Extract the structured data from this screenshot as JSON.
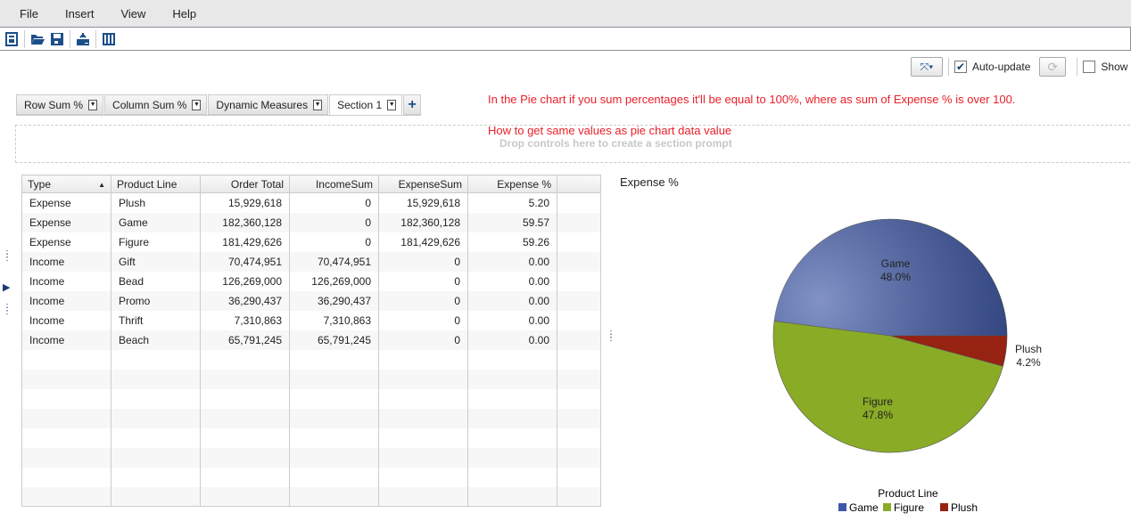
{
  "menu": [
    "File",
    "Insert",
    "View",
    "Help"
  ],
  "toolbar_icons": [
    "new-report-icon",
    "open-folder-icon",
    "save-icon",
    "export-icon",
    "layout-icon"
  ],
  "right_tools": {
    "auto_update_label": "Auto-update",
    "auto_update_checked": true,
    "show_label": "Show",
    "show_checked": false
  },
  "tabs": [
    {
      "label": "Row Sum %"
    },
    {
      "label": "Column Sum %"
    },
    {
      "label": "Dynamic Measures"
    },
    {
      "label": "Section 1",
      "active": true
    }
  ],
  "notes": {
    "line1": "In the Pie chart if you sum percentages it'll be equal to 100%, where as sum of Expense % is over 100.",
    "line2": "How to get same values as pie chart data value"
  },
  "section_prompt": "Drop controls here to create a section prompt",
  "table": {
    "columns": [
      "Type",
      "Product Line",
      "Order Total",
      "IncomeSum",
      "ExpenseSum",
      "Expense %"
    ],
    "sort_column": "Type",
    "sort_dir": "asc",
    "rows": [
      [
        "Expense",
        "Plush",
        "15,929,618",
        "0",
        "15,929,618",
        "5.20"
      ],
      [
        "Expense",
        "Game",
        "182,360,128",
        "0",
        "182,360,128",
        "59.57"
      ],
      [
        "Expense",
        "Figure",
        "181,429,626",
        "0",
        "181,429,626",
        "59.26"
      ],
      [
        "Income",
        "Gift",
        "70,474,951",
        "70,474,951",
        "0",
        "0.00"
      ],
      [
        "Income",
        "Bead",
        "126,269,000",
        "126,269,000",
        "0",
        "0.00"
      ],
      [
        "Income",
        "Promo",
        "36,290,437",
        "36,290,437",
        "0",
        "0.00"
      ],
      [
        "Income",
        "Thrift",
        "7,310,863",
        "7,310,863",
        "0",
        "0.00"
      ],
      [
        "Income",
        "Beach",
        "65,791,245",
        "65,791,245",
        "0",
        "0.00"
      ]
    ]
  },
  "chart_data": {
    "type": "pie",
    "title": "Expense %",
    "legend_title": "Product Line",
    "legend_position": "bottom",
    "slices": [
      {
        "label": "Game",
        "value": 48.0,
        "display": "48.0%",
        "color": "#3e58a8"
      },
      {
        "label": "Figure",
        "value": 47.8,
        "display": "47.8%",
        "color": "#8aab26"
      },
      {
        "label": "Plush",
        "value": 4.2,
        "display": "4.2%",
        "color": "#962212"
      }
    ]
  }
}
